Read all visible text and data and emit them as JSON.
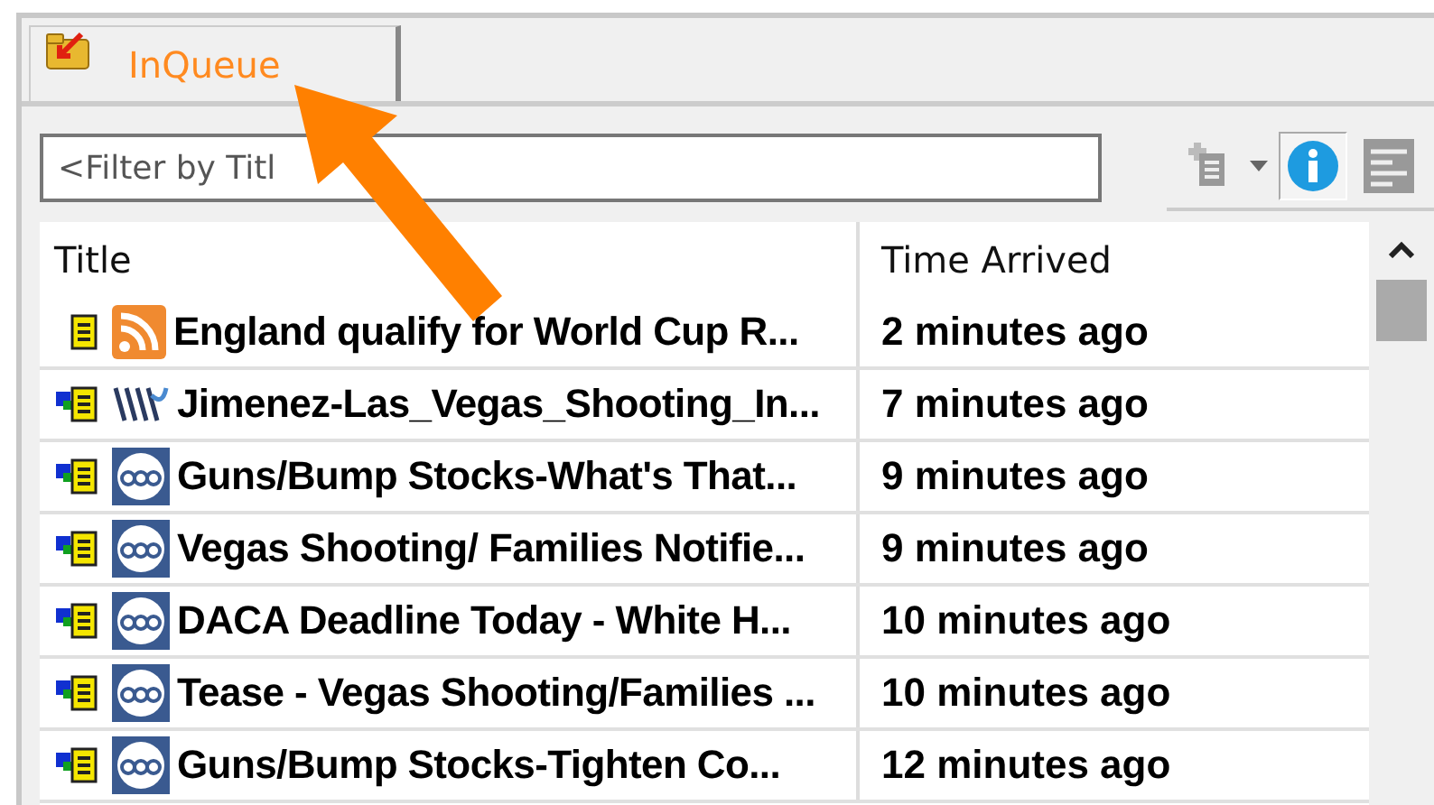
{
  "tab": {
    "label": "InQueue",
    "selected": true
  },
  "filter": {
    "placeholder": "<Filter by Titl"
  },
  "toolbar": [
    {
      "kind": "add",
      "selected": false
    },
    {
      "kind": "dropdown",
      "selected": false
    },
    {
      "kind": "info",
      "selected": true
    },
    {
      "kind": "details",
      "selected": false
    }
  ],
  "table": {
    "columns": [
      "Title",
      "Time Arrived"
    ],
    "rows": [
      {
        "marked": false,
        "kind": "rss",
        "title": "England qualify for World Cup R...",
        "time": "2 minutes ago"
      },
      {
        "marked": true,
        "kind": "waves",
        "title": "Jimenez-Las_Vegas_Shooting_In...",
        "time": "7 minutes ago"
      },
      {
        "marked": true,
        "kind": "circle",
        "title": "Guns/Bump Stocks-What's That...",
        "time": "9 minutes ago"
      },
      {
        "marked": true,
        "kind": "circle",
        "title": "Vegas Shooting/ Families Notifie...",
        "time": "9 minutes ago"
      },
      {
        "marked": true,
        "kind": "circle",
        "title": "DACA Deadline Today - White H...",
        "time": "10 minutes ago"
      },
      {
        "marked": true,
        "kind": "circle",
        "title": "Tease - Vegas Shooting/Families ...",
        "time": "10 minutes ago"
      },
      {
        "marked": true,
        "kind": "circle",
        "title": "Guns/Bump Stocks-Tighten Co...",
        "time": "12 minutes ago"
      }
    ]
  }
}
